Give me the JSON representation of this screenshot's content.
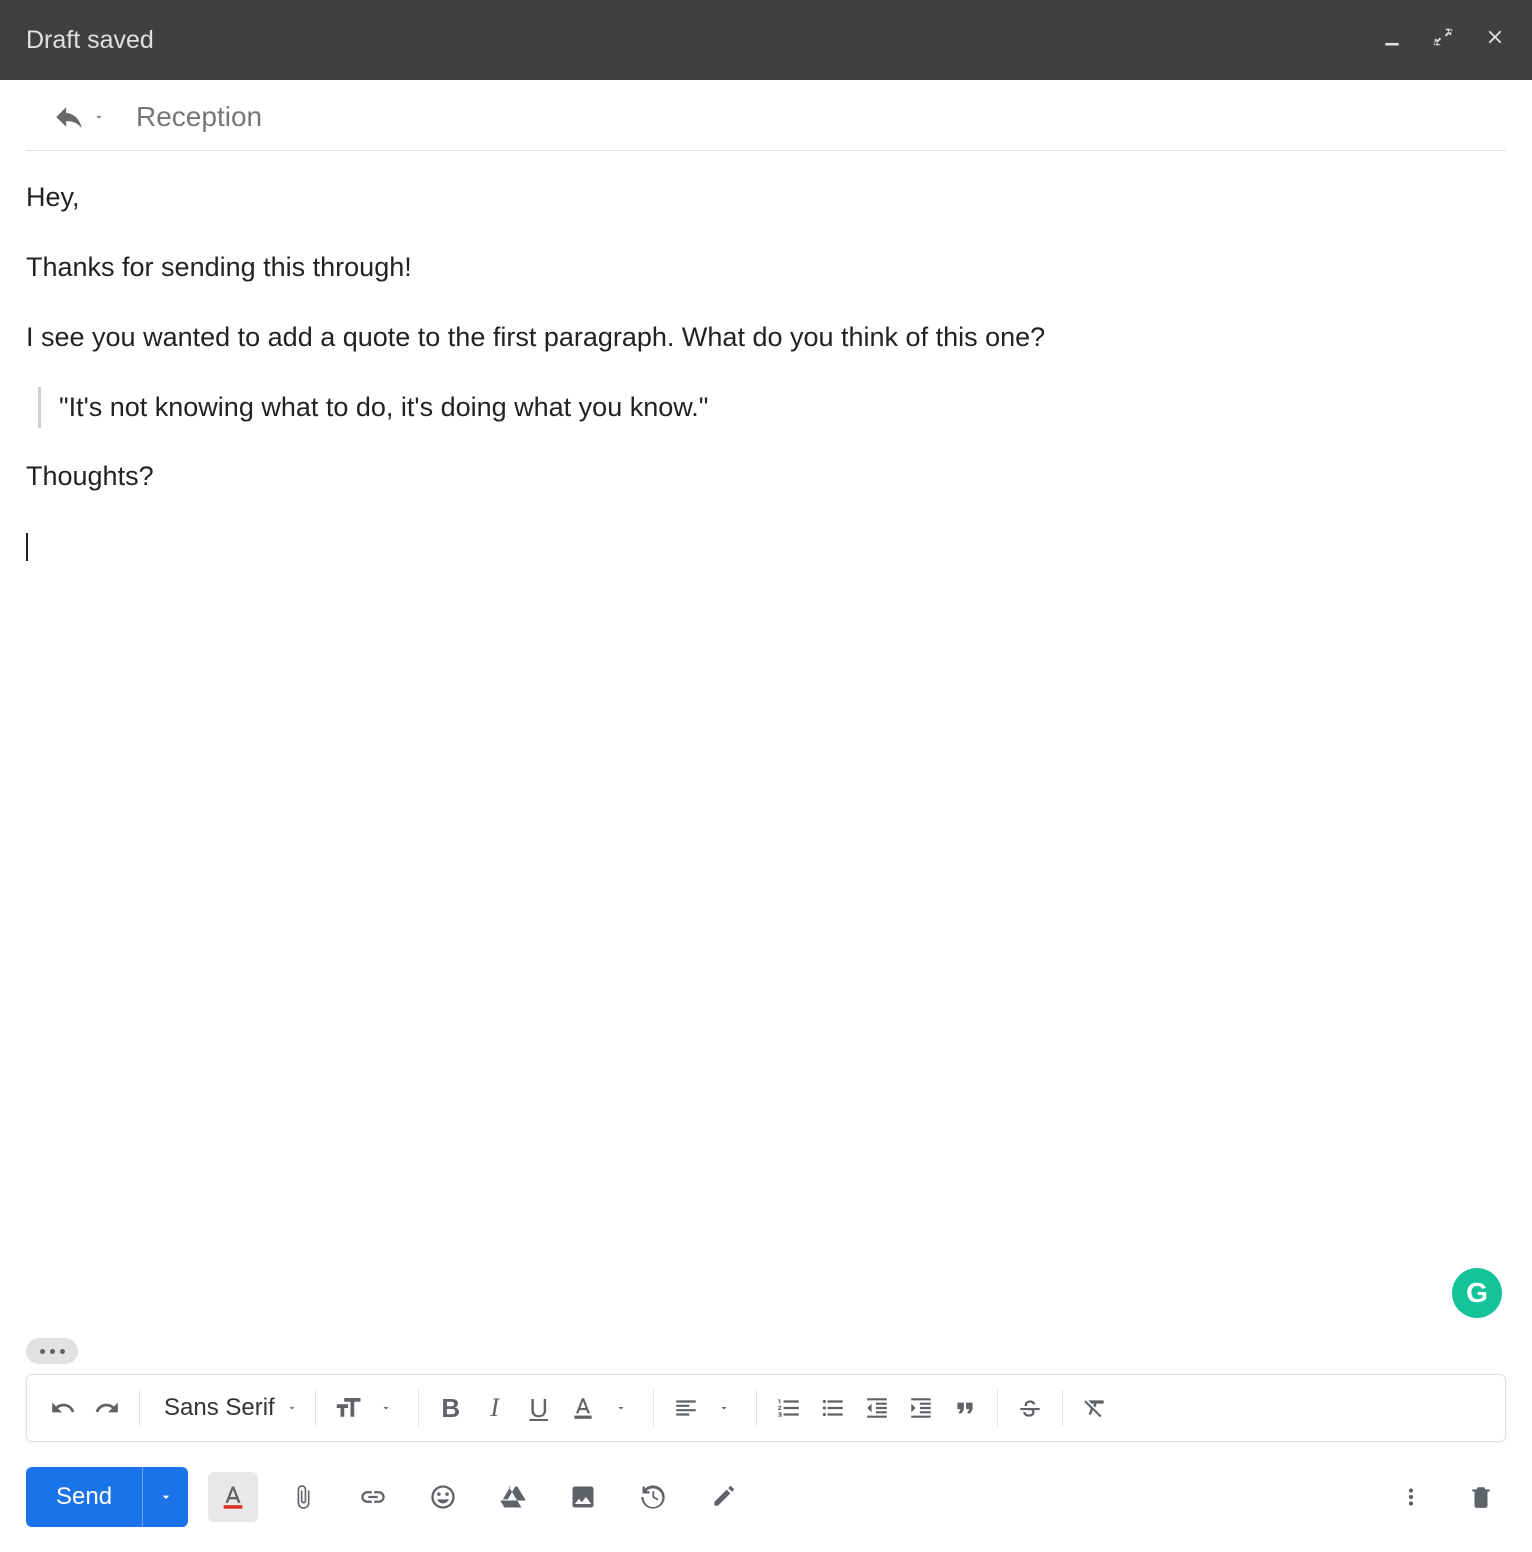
{
  "header": {
    "title": "Draft saved"
  },
  "subject": "Reception",
  "body": {
    "p1": "Hey,",
    "p2": "Thanks for sending this through!",
    "p3": "I see you wanted to add a quote to the first paragraph. What do you think of this one?",
    "quote": "\"It's not knowing what to do, it's doing what you know.\"",
    "p4": "Thoughts?"
  },
  "toolbar": {
    "font": "Sans Serif"
  },
  "send": {
    "label": "Send"
  },
  "grammar_badge": "G"
}
